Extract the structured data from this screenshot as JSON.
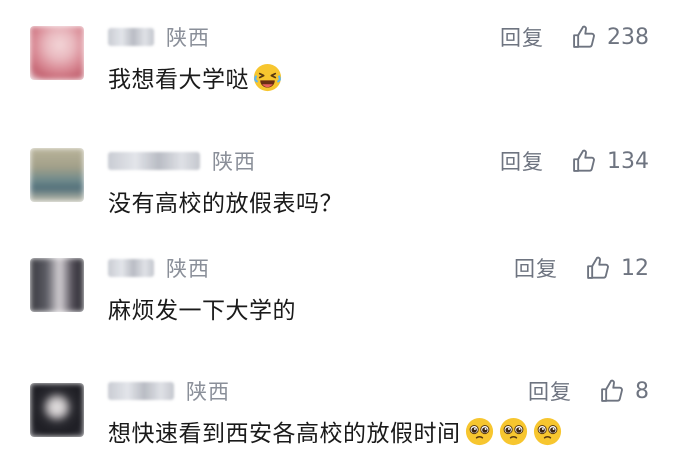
{
  "comments": [
    {
      "location": "陕西",
      "reply_label": "回复",
      "likes": "238",
      "text": "我想看大学哒",
      "emoji_names": [
        "laughing-tears-emoji"
      ]
    },
    {
      "location": "陕西",
      "reply_label": "回复",
      "likes": "134",
      "text": "没有高校的放假表吗？",
      "emoji_names": []
    },
    {
      "location": "陕西",
      "reply_label": "回复",
      "likes": "12",
      "text": "麻烦发一下大学的",
      "emoji_names": []
    },
    {
      "location": "陕西",
      "reply_label": "回复",
      "likes": "8",
      "text": "想快速看到西安各高校的放假时间",
      "emoji_names": [
        "pleading-face-emoji",
        "pleading-face-emoji",
        "pleading-face-emoji"
      ]
    }
  ],
  "colors": {
    "meta_text": "#8a8f99",
    "action_text": "#6e7480",
    "body_text": "#1a1a1a",
    "emoji_yellow": "#f7c62f"
  }
}
